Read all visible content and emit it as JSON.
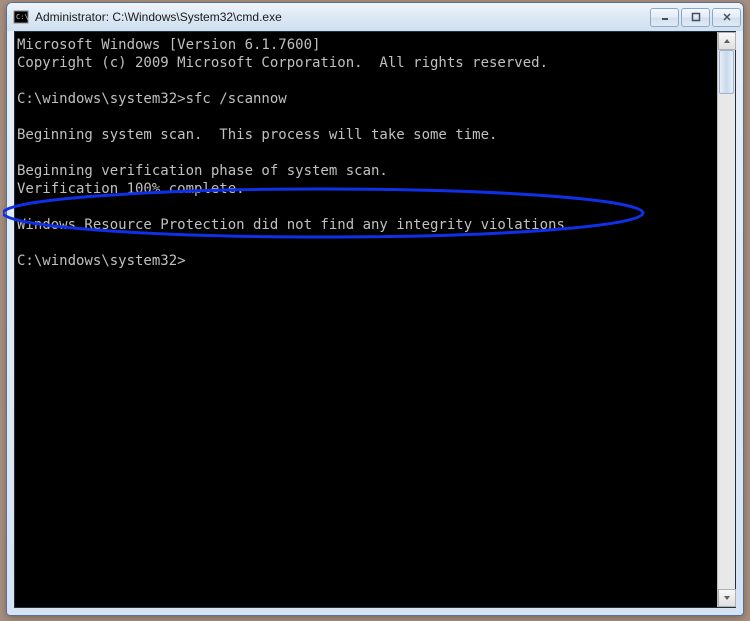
{
  "window": {
    "title": "Administrator: C:\\Windows\\System32\\cmd.exe"
  },
  "terminal": {
    "line1": "Microsoft Windows [Version 6.1.7600]",
    "line2": "Copyright (c) 2009 Microsoft Corporation.  All rights reserved.",
    "blank1": "",
    "prompt1": "C:\\windows\\system32>sfc /scannow",
    "blank2": "",
    "msg1": "Beginning system scan.  This process will take some time.",
    "blank3": "",
    "msg2": "Beginning verification phase of system scan.",
    "msg3": "Verification 100% complete.",
    "blank4": "",
    "result": "Windows Resource Protection did not find any integrity violations.",
    "blank5": "",
    "prompt2": "C:\\windows\\system32>"
  },
  "annotation": {
    "stroke": "#1030e8"
  }
}
